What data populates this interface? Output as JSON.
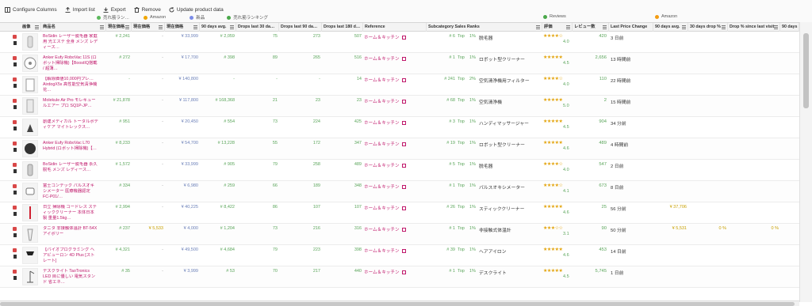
{
  "toolbar": {
    "configure": "Configure Columns",
    "import": "Import list",
    "export": "Export",
    "remove": "Remove",
    "update": "Update product data"
  },
  "legend": {
    "sales_rank": "売れ筋ラン…",
    "amazon": "Amazon",
    "new": "新品",
    "sales_ranking": "売れ筋ランキング",
    "reviews": "Reviews",
    "amazon2": "Amazon",
    "colors": {
      "green": "#5cb85c",
      "orange": "#f0a500",
      "blue": "#7b8ce8",
      "green2": "#4aa84a",
      "orange2": "#f39c12"
    }
  },
  "columns": {
    "image": "画像",
    "name": "商品名",
    "current_price": "現在価格",
    "current_price2": "現在価格",
    "current_price3": "現在価格",
    "avg90": "90 days avg.",
    "drops30": "Drops last 30 da…",
    "drops90": "Drops last 90 da…",
    "drops180": "Drops last 180 d…",
    "reference": "Reference",
    "subcat": "Subcategory Sales Ranks",
    "rating": "評価",
    "review_count": "レビュー数",
    "last_price_change": "Last Price Change",
    "avg90b": "90 days avg.",
    "drop30pct": "30 days drop %",
    "drop_since": "Drop % since last visit",
    "avg90c": "90 days"
  },
  "rows": [
    {
      "name": "BoSidin レーザー脱毛器 家庭用 光エステ 全身 メンズ レディース…",
      "rank_cur": "# 2,241",
      "p2": "-",
      "price": "¥ 33,999",
      "rank_avg": "# 2,059",
      "d30": "75",
      "d90": "273",
      "d180": "507",
      "ref": "ホーム＆キッチン",
      "subrank": "# 6",
      "top": "Top",
      "pct": "1%",
      "cat": "脱毛器",
      "stars": "★★★★☆",
      "rating": "4.0",
      "reviews": "420",
      "last": "3 日前"
    },
    {
      "name": "Anker Eufy RoboVac 11S (ロボット掃除機)【BoostIQ搭載 / 超薄…",
      "rank_cur": "# 272",
      "p2": "-",
      "price": "¥ 17,700",
      "rank_avg": "# 398",
      "d30": "89",
      "d90": "265",
      "d180": "516",
      "ref": "ホーム＆キッチン",
      "subrank": "# 1",
      "top": "Top",
      "pct": "1%",
      "cat": "ロボット型クリーナー",
      "stars": "★★★★★",
      "rating": "4.5",
      "reviews": "2,656",
      "last": "13 時間前"
    },
    {
      "name": "【解除価値10,000円プレ… AirdogX5s 高性能空気清浄機 花…",
      "rank_cur": "-",
      "p2": "-",
      "price": "¥ 140,800",
      "rank_avg": "-",
      "d30": "-",
      "d90": "-",
      "d180": "14",
      "ref": "ホーム＆キッチン",
      "subrank": "# 241",
      "top": "Top",
      "pct": "2%",
      "cat": "空気清浄機用フィルター",
      "stars": "★★★★☆",
      "rating": "4.0",
      "reviews": "110",
      "last": "22 時間前"
    },
    {
      "name": "Molekule Air Pro モレキュールエアー プロ SQ1P-JP…",
      "rank_cur": "# 21,878",
      "p2": "-",
      "price": "¥ 117,800",
      "rank_avg": "# 168,368",
      "d30": "21",
      "d90": "23",
      "d180": "23",
      "ref": "ホーム＆キッチン",
      "subrank": "# 68",
      "top": "Top",
      "pct": "1%",
      "cat": "空気清浄機",
      "stars": "★★★★★",
      "rating": "5.0",
      "reviews": "2",
      "last": "15 時間前"
    },
    {
      "name": "創建メディカル トータルボディケア マイトレックス…",
      "rank_cur": "# 951",
      "p2": "-",
      "price": "¥ 20,450",
      "rank_avg": "# 554",
      "d30": "73",
      "d90": "224",
      "d180": "425",
      "ref": "ホーム＆キッチン",
      "subrank": "# 3",
      "top": "Top",
      "pct": "1%",
      "cat": "ハンディマッサージャー",
      "stars": "★★★★★",
      "rating": "4.5",
      "reviews": "904",
      "last": "34 分前"
    },
    {
      "name": "Anker Eufy RoboVac L70 Hybrid (ロボット掃除機)【…",
      "rank_cur": "# 8,233",
      "p2": "-",
      "price": "¥ 54,700",
      "rank_avg": "# 13,228",
      "d30": "55",
      "d90": "172",
      "d180": "347",
      "ref": "ホーム＆キッチン",
      "subrank": "# 19",
      "top": "Top",
      "pct": "1%",
      "cat": "ロボット型クリーナー",
      "stars": "★★★★★",
      "rating": "4.6",
      "reviews": "489",
      "last": "4 時間前"
    },
    {
      "name": "BoSidin レーザー脱毛器 永久脱毛 メンズ レディース…",
      "rank_cur": "# 1,572",
      "p2": "-",
      "price": "¥ 33,999",
      "rank_avg": "# 905",
      "d30": "79",
      "d90": "258",
      "d180": "489",
      "ref": "ホーム＆キッチン",
      "subrank": "# 5",
      "top": "Top",
      "pct": "1%",
      "cat": "脱毛器",
      "stars": "★★★★☆",
      "rating": "4.0",
      "reviews": "547",
      "last": "2 日前"
    },
    {
      "name": "富士コンテック パルスオキシメーター 医療機器認定 FC-P01/…",
      "rank_cur": "# 334",
      "p2": "-",
      "price": "¥ 6,980",
      "rank_avg": "# 259",
      "d30": "66",
      "d90": "189",
      "d180": "348",
      "ref": "ホーム＆キッチン",
      "subrank": "# 1",
      "top": "Top",
      "pct": "1%",
      "cat": "パルスオキシメーター",
      "stars": "★★★★☆",
      "rating": "4.1",
      "reviews": "673",
      "last": "8 日前"
    },
    {
      "name": "日立 掃除機 コードレス スティッククリーナー 本体日本製 重量1.5kg…",
      "rank_cur": "# 2,994",
      "p2": "-",
      "price": "¥ 40,225",
      "rank_avg": "# 8,422",
      "d30": "86",
      "d90": "107",
      "d180": "107",
      "ref": "ホーム＆キッチン",
      "subrank": "# 26",
      "top": "Top",
      "pct": "1%",
      "cat": "スティッククリーナー",
      "stars": "★★★★★",
      "rating": "4.6",
      "reviews": "25",
      "last": "56 分前",
      "extra_price": "¥ 37,706"
    },
    {
      "name": "タニタ 非接触体温計 BT-54X アイボリー",
      "rank_cur": "# 237",
      "p2": "¥ 5,533",
      "price": "¥ 4,000",
      "rank_avg": "# 1,204",
      "d30": "73",
      "d90": "216",
      "d180": "316",
      "ref": "ホーム＆キッチン",
      "subrank": "# 1",
      "top": "Top",
      "pct": "1%",
      "cat": "非接触式体温計",
      "stars": "★★★☆☆",
      "rating": "3.1",
      "reviews": "90",
      "last": "50 分前",
      "extra_price": "¥ 5,531",
      "extra_pct": "0 %",
      "extra_pct2": "0 %"
    },
    {
      "name": "【パイオプログラミング ヘアビューロン 4D Plus [ストレート]",
      "rank_cur": "# 4,321",
      "p2": "-",
      "price": "¥ 49,500",
      "rank_avg": "# 4,684",
      "d30": "79",
      "d90": "223",
      "d180": "398",
      "ref": "ホーム＆キッチン",
      "subrank": "# 39",
      "top": "Top",
      "pct": "1%",
      "cat": "ヘアアイロン",
      "stars": "★★★★★",
      "rating": "4.6",
      "reviews": "453",
      "last": "14 日前"
    },
    {
      "name": "デスクライト TaoTronics LED 目に優しい 電気スタンド 省エネ…",
      "rank_cur": "# 35",
      "p2": "-",
      "price": "¥ 3,999",
      "rank_avg": "# 53",
      "d30": "70",
      "d90": "217",
      "d180": "440",
      "ref": "ホーム＆キッチン",
      "subrank": "# 1",
      "top": "Top",
      "pct": "1%",
      "cat": "デスクライト",
      "stars": "★★★★★",
      "rating": "4.5",
      "reviews": "5,745",
      "last": "1 日前"
    }
  ]
}
